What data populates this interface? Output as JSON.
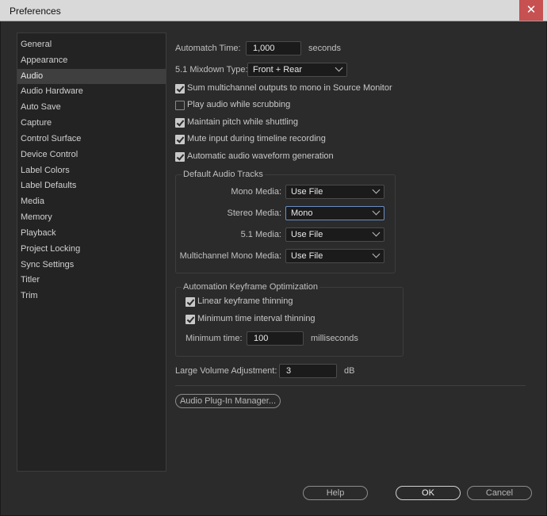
{
  "window": {
    "title": "Preferences",
    "close_glyph": "✕"
  },
  "sidebar": {
    "items": [
      {
        "label": "General"
      },
      {
        "label": "Appearance"
      },
      {
        "label": "Audio"
      },
      {
        "label": "Audio Hardware"
      },
      {
        "label": "Auto Save"
      },
      {
        "label": "Capture"
      },
      {
        "label": "Control Surface"
      },
      {
        "label": "Device Control"
      },
      {
        "label": "Label Colors"
      },
      {
        "label": "Label Defaults"
      },
      {
        "label": "Media"
      },
      {
        "label": "Memory"
      },
      {
        "label": "Playback"
      },
      {
        "label": "Project Locking"
      },
      {
        "label": "Sync Settings"
      },
      {
        "label": "Titler"
      },
      {
        "label": "Trim"
      }
    ],
    "selected": "Audio"
  },
  "audio": {
    "automatch_label": "Automatch Time:",
    "automatch_value": "1,000",
    "automatch_unit": "seconds",
    "mixdown_label": "5.1 Mixdown Type:",
    "mixdown_value": "Front + Rear",
    "checks": [
      {
        "label": "Sum multichannel outputs to mono in Source Monitor",
        "checked": true
      },
      {
        "label": "Play audio while scrubbing",
        "checked": false
      },
      {
        "label": "Maintain pitch while shuttling",
        "checked": true
      },
      {
        "label": "Mute input during timeline recording",
        "checked": true
      },
      {
        "label": "Automatic audio waveform generation",
        "checked": true
      }
    ],
    "tracks_group": {
      "label": "Default Audio Tracks",
      "rows": [
        {
          "label": "Mono Media:",
          "value": "Use File"
        },
        {
          "label": "Stereo Media:",
          "value": "Mono"
        },
        {
          "label": "5.1 Media:",
          "value": "Use File"
        },
        {
          "label": "Multichannel Mono Media:",
          "value": "Use File"
        }
      ]
    },
    "keyframe_group": {
      "label": "Automation Keyframe Optimization",
      "checks": [
        {
          "label": "Linear keyframe thinning",
          "checked": true
        },
        {
          "label": "Minimum time interval thinning",
          "checked": true
        }
      ],
      "min_time_label": "Minimum time:",
      "min_time_value": "100",
      "min_time_unit": "milliseconds"
    },
    "volume_label": "Large Volume Adjustment:",
    "volume_value": "3",
    "volume_unit": "dB",
    "plugin_button": "Audio Plug-In Manager..."
  },
  "footer": {
    "help": "Help",
    "ok": "OK",
    "cancel": "Cancel"
  },
  "colors": {
    "background": "#2b2b2b",
    "titlebar": "#d9d9d9",
    "close": "#c75050",
    "focus": "#6a8fc4"
  }
}
